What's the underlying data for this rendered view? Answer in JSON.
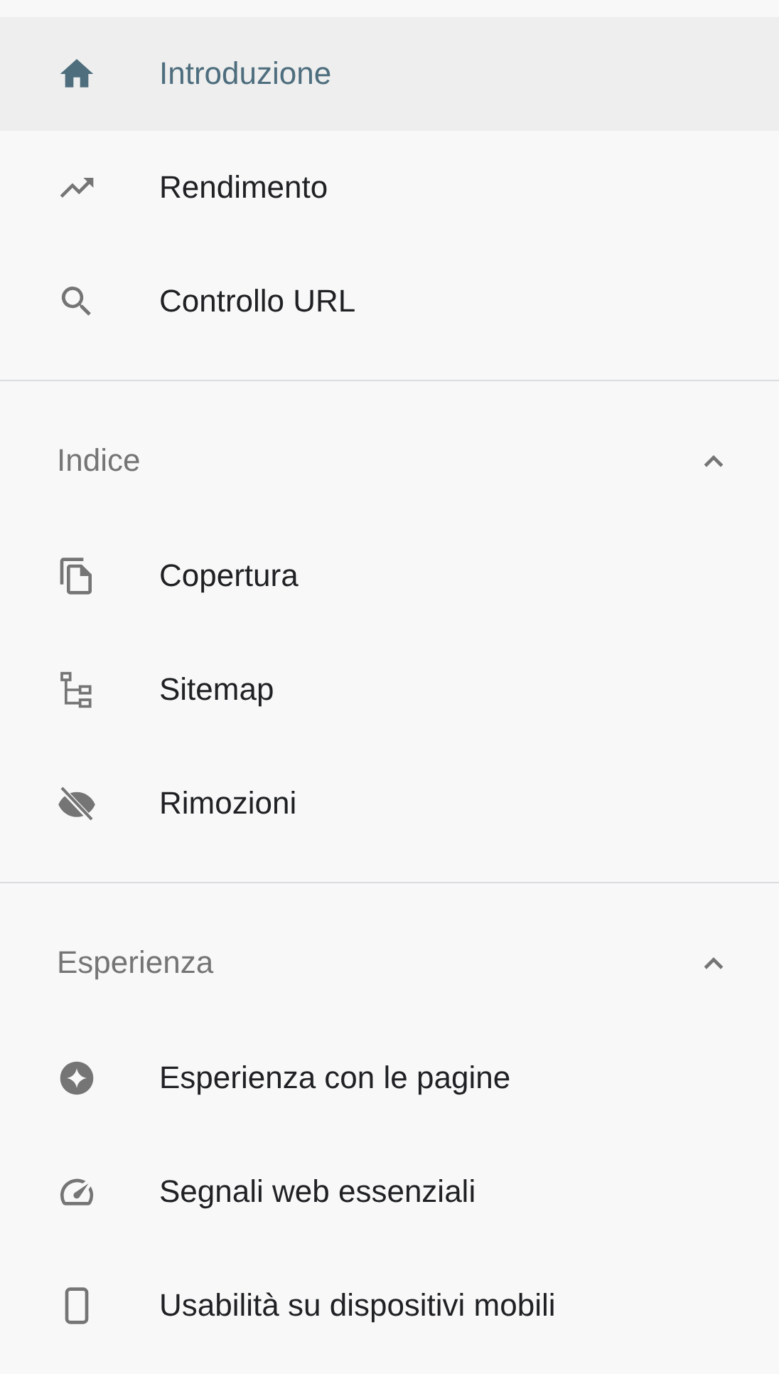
{
  "sections": [
    {
      "items": [
        {
          "label": "Introduzione",
          "selected": true
        },
        {
          "label": "Rendimento",
          "selected": false
        },
        {
          "label": "Controllo URL",
          "selected": false
        }
      ]
    },
    {
      "title": "Indice",
      "expanded": true,
      "items": [
        {
          "label": "Copertura",
          "selected": false
        },
        {
          "label": "Sitemap",
          "selected": false
        },
        {
          "label": "Rimozioni",
          "selected": false
        }
      ]
    },
    {
      "title": "Esperienza",
      "expanded": true,
      "items": [
        {
          "label": "Esperienza con le pagine",
          "selected": false
        },
        {
          "label": "Segnali web essenziali",
          "selected": false
        },
        {
          "label": "Usabilità su dispositivi mobili",
          "selected": false
        }
      ]
    }
  ]
}
